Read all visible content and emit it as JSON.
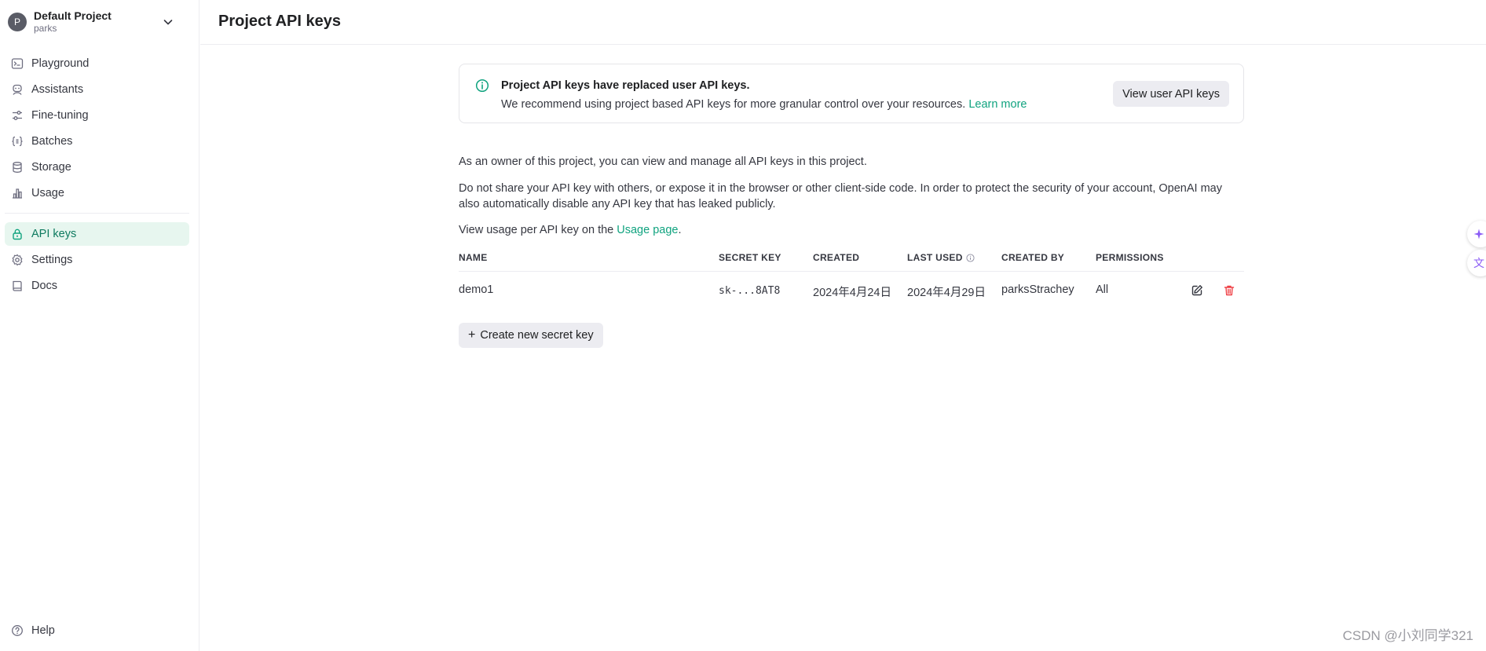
{
  "project": {
    "avatar_letter": "P",
    "name": "Default Project",
    "org": "parks"
  },
  "sidebar": {
    "items": [
      {
        "label": "Playground",
        "icon": "terminal-icon"
      },
      {
        "label": "Assistants",
        "icon": "robot-icon"
      },
      {
        "label": "Fine-tuning",
        "icon": "sliders-icon"
      },
      {
        "label": "Batches",
        "icon": "braces-icon"
      },
      {
        "label": "Storage",
        "icon": "database-icon"
      },
      {
        "label": "Usage",
        "icon": "bar-chart-icon"
      }
    ],
    "items2": [
      {
        "label": "API keys",
        "icon": "lock-icon",
        "active": true
      },
      {
        "label": "Settings",
        "icon": "gear-icon"
      },
      {
        "label": "Docs",
        "icon": "book-icon"
      }
    ],
    "help": "Help"
  },
  "header": {
    "title": "Project API keys"
  },
  "notice": {
    "title": "Project API keys have replaced user API keys.",
    "body": "We recommend using project based API keys for more granular control over your resources.",
    "link": "Learn more",
    "button": "View user API keys"
  },
  "info": {
    "p1": "As an owner of this project, you can view and manage all API keys in this project.",
    "p2": "Do not share your API key with others, or expose it in the browser or other client-side code. In order to protect the security of your account, OpenAI may also automatically disable any API key that has leaked publicly.",
    "p3_prefix": "View usage per API key on the",
    "p3_link": "Usage page",
    "p3_suffix": "."
  },
  "table": {
    "headers": [
      "NAME",
      "SECRET KEY",
      "CREATED",
      "LAST USED",
      "CREATED BY",
      "PERMISSIONS"
    ],
    "rows": [
      {
        "name": "demo1",
        "secret": "sk-...8AT8",
        "created": "2024年4月24日",
        "last_used": "2024年4月29日",
        "created_by": "parksStrachey",
        "permissions": "All"
      }
    ]
  },
  "create_button": "Create new secret key",
  "watermark": "CSDN @小刘同学321",
  "colors": {
    "accent": "#10a37f",
    "active_bg": "#e7f6ef",
    "danger": "#ef4146"
  }
}
